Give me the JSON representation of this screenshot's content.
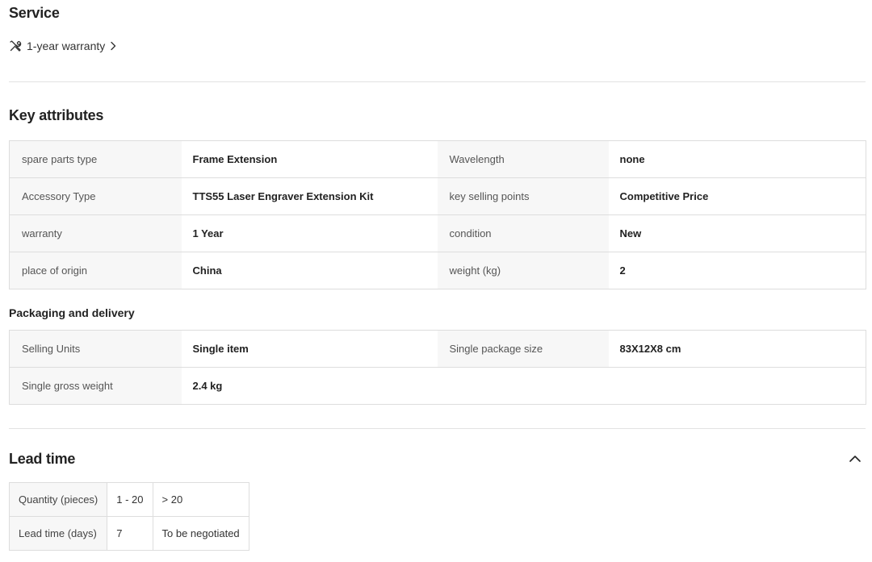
{
  "service": {
    "title": "Service",
    "warranty_link": "1-year warranty"
  },
  "key_attributes": {
    "title": "Key attributes",
    "rows": [
      [
        {
          "k": "spare parts type",
          "v": "Frame Extension"
        },
        {
          "k": "Wavelength",
          "v": "none"
        }
      ],
      [
        {
          "k": "Accessory Type",
          "v": "TTS55 Laser Engraver Extension Kit"
        },
        {
          "k": "key selling points",
          "v": "Competitive Price"
        }
      ],
      [
        {
          "k": "warranty",
          "v": "1 Year"
        },
        {
          "k": "condition",
          "v": "New"
        }
      ],
      [
        {
          "k": "place of origin",
          "v": "China"
        },
        {
          "k": "weight (kg)",
          "v": "2"
        }
      ]
    ]
  },
  "packaging": {
    "title": "Packaging and delivery",
    "rows": [
      [
        {
          "k": "Selling Units",
          "v": "Single item"
        },
        {
          "k": "Single package size",
          "v": "83X12X8 cm"
        }
      ],
      [
        {
          "k": "Single gross weight",
          "v": "2.4 kg"
        },
        {
          "k": "",
          "v": ""
        }
      ]
    ]
  },
  "lead_time": {
    "title": "Lead time",
    "header": [
      "Quantity (pieces)",
      "1 - 20",
      "> 20"
    ],
    "row": [
      "Lead time (days)",
      "7",
      "To be negotiated"
    ]
  },
  "icons": {
    "service": "tools-icon",
    "link": "chevron-right-icon",
    "collapse": "chevron-up-icon"
  },
  "colors": {
    "text": "#222222",
    "key_bg": "#f7f7f7",
    "border": "#dddddd"
  }
}
